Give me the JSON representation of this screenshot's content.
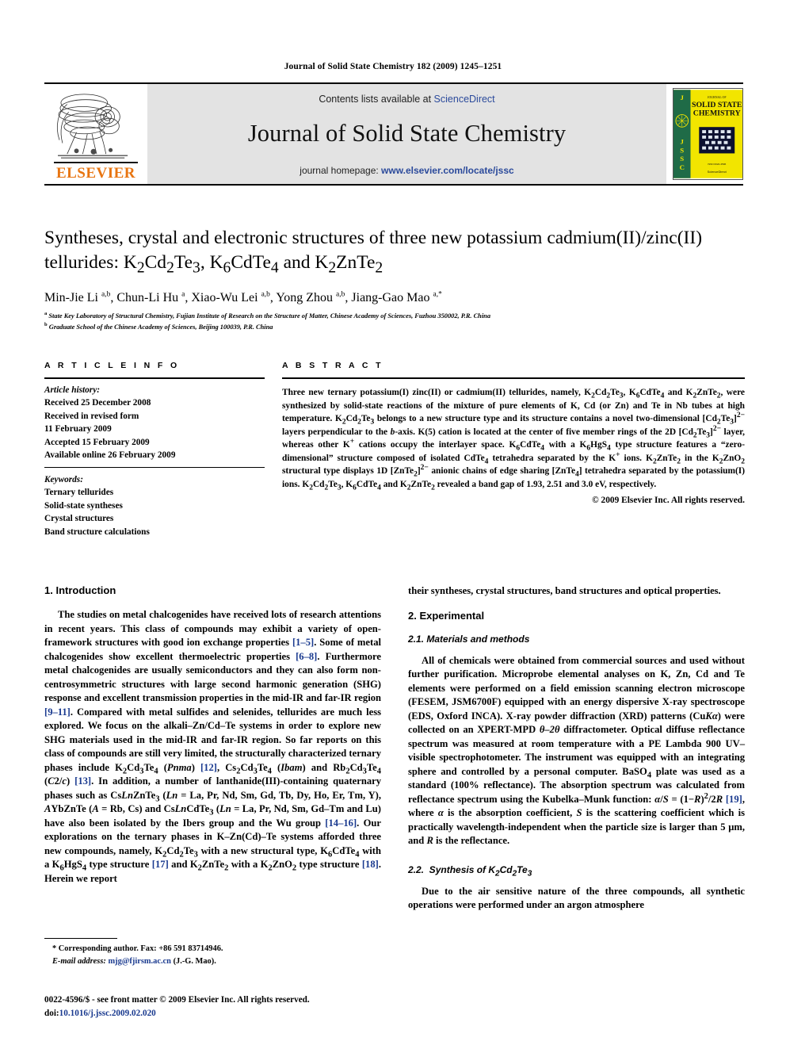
{
  "running_head": "Journal of Solid State Chemistry 182 (2009) 1245–1251",
  "masthead": {
    "contents_prefix": "Contents lists available at ",
    "contents_link": "ScienceDirect",
    "journal_title": "Journal of Solid State Chemistry",
    "homepage_prefix": "journal homepage: ",
    "homepage_link": "www.elsevier.com/locate/jssc",
    "publisher_name": "ELSEVIER",
    "cover_line1": "Journal of",
    "cover_line2": "SOLID STATE",
    "cover_line3": "CHEMISTRY",
    "cover_spine": "JSSC",
    "cover_footer": "ScienceDirect"
  },
  "article": {
    "title_line1": "Syntheses, crystal and electronic structures of three new potassium",
    "title_line2_pre": "cadmium(II)/zinc(II) tellurides: K",
    "title_full": "Syntheses, crystal and electronic structures of three new potassium cadmium(II)/zinc(II) tellurides: K2Cd2Te3, K6CdTe4 and K2ZnTe2",
    "authors": "Min-Jie Li a,b, Chun-Li Hu a, Xiao-Wu Lei a,b, Yong Zhou a,b, Jiang-Gao Mao a,*",
    "affiliation_a": "State Key Laboratory of Structural Chemistry, Fujian Institute of Research on the Structure of Matter, Chinese Academy of Sciences, Fuzhou 350002, P.R. China",
    "affiliation_b": "Graduate School of the Chinese Academy of Sciences, Beijing 100039, P.R. China"
  },
  "article_info": {
    "heading": "A R T I C L E   I N F O",
    "history_label": "Article history:",
    "history": [
      "Received 25 December 2008",
      "Received in revised form",
      "11 February 2009",
      "Accepted 15 February 2009",
      "Available online 26 February 2009"
    ],
    "keywords_label": "Keywords:",
    "keywords": [
      "Ternary tellurides",
      "Solid-state syntheses",
      "Crystal structures",
      "Band structure calculations"
    ]
  },
  "abstract": {
    "heading": "A B S T R A C T",
    "copyright": "© 2009 Elsevier Inc. All rights reserved."
  },
  "sections": {
    "intro_heading": "1.  Introduction",
    "experimental_heading": "2.  Experimental",
    "materials_heading": "2.1.  Materials and methods",
    "synthesis_heading_pre": "2.2.  Synthesis of K"
  },
  "footnotes": {
    "corresponding": "* Corresponding author. Fax: +86 591 83714946.",
    "email_label": "E-mail address:",
    "email": "mjg@fjirsm.ac.cn",
    "email_suffix": "(J.-G. Mao).",
    "issn_line": "0022-4596/$ - see front matter © 2009 Elsevier Inc. All rights reserved.",
    "doi_label": "doi:",
    "doi": "10.1016/j.jssc.2009.02.020"
  },
  "colors": {
    "link": "#2b4a9b",
    "reference": "#1a3a8f",
    "elsevier_orange": "#E87511",
    "masthead_bg": "#e3e3e3",
    "cover_yellow": "#f2e500",
    "cover_green": "#1f6b47"
  }
}
